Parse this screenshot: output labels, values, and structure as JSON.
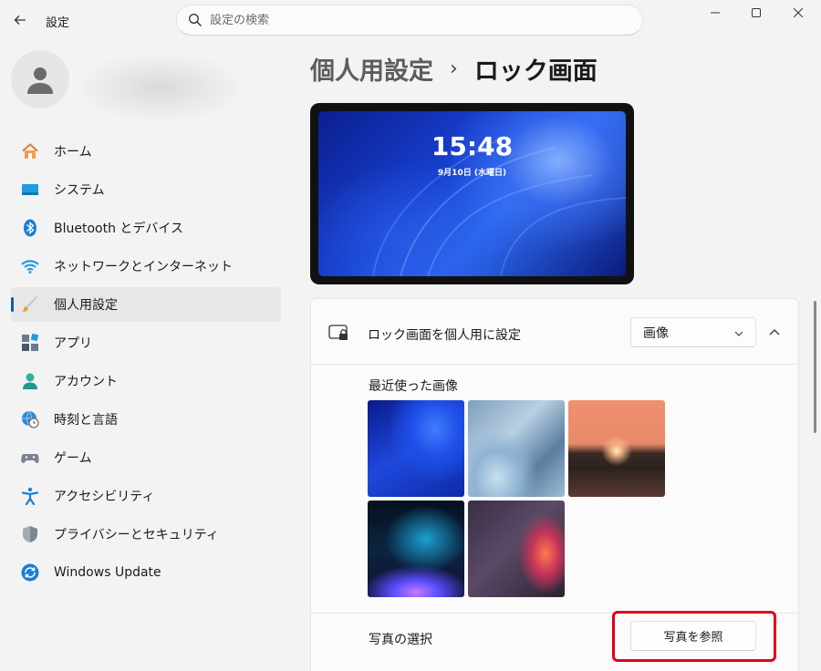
{
  "window": {
    "title": "設定",
    "search_placeholder": "設定の検索"
  },
  "sidebar": {
    "items": [
      {
        "label": "ホーム",
        "icon": "home-icon"
      },
      {
        "label": "システム",
        "icon": "system-icon"
      },
      {
        "label": "Bluetooth とデバイス",
        "icon": "bluetooth-icon"
      },
      {
        "label": "ネットワークとインターネット",
        "icon": "wifi-icon"
      },
      {
        "label": "個人用設定",
        "icon": "brush-icon",
        "selected": true
      },
      {
        "label": "アプリ",
        "icon": "apps-icon"
      },
      {
        "label": "アカウント",
        "icon": "account-icon"
      },
      {
        "label": "時刻と言語",
        "icon": "globe-clock-icon"
      },
      {
        "label": "ゲーム",
        "icon": "gamepad-icon"
      },
      {
        "label": "アクセシビリティ",
        "icon": "accessibility-icon"
      },
      {
        "label": "プライバシーとセキュリティ",
        "icon": "shield-icon"
      },
      {
        "label": "Windows Update",
        "icon": "update-icon"
      }
    ]
  },
  "breadcrumb": {
    "parent": "個人用設定",
    "current": "ロック画面"
  },
  "preview": {
    "time": "15:48",
    "date": "9月10日 (水曜日)"
  },
  "lockscreen": {
    "personalize_label": "ロック画面を個人用に設定",
    "mode_value": "画像",
    "recent_images_label": "最近使った画像",
    "choose_photo_label": "写真の選択",
    "browse_button": "写真を参照"
  },
  "colors": {
    "accent": "#005fb8",
    "highlight_box": "#e0001a"
  }
}
